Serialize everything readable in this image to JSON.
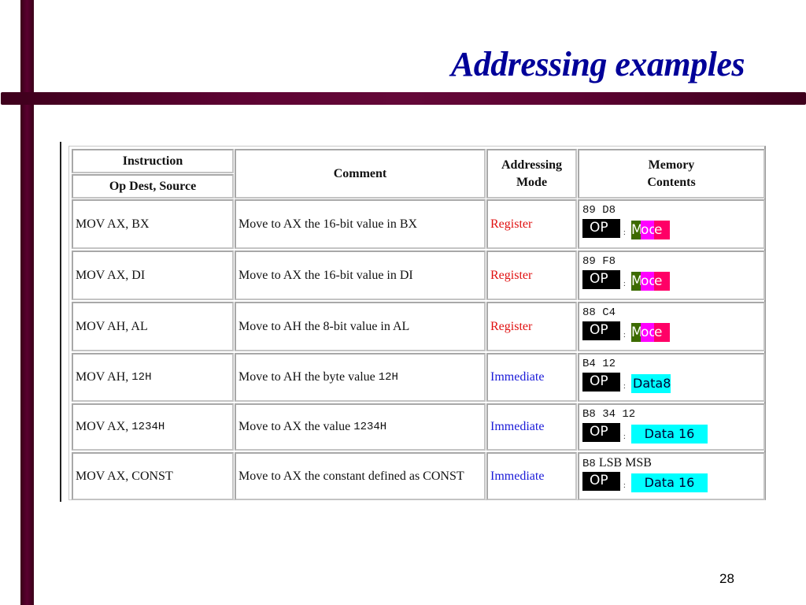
{
  "slide": {
    "title": "Addressing examples",
    "page_number": "28",
    "colors": {
      "title": "#000099",
      "bars": "#5a0030",
      "register": "#e01010",
      "immediate": "#1a1ad8",
      "op_box": "#000000",
      "mode_box_segments": [
        "#3d6a00",
        "#ff00ff",
        "#ff0066"
      ],
      "data_box": "#00ffff"
    }
  },
  "table": {
    "headers": {
      "instruction": "Instruction",
      "op_dest_source": "Op Dest, Source",
      "comment": "Comment",
      "addressing_mode_line1": "Addressing",
      "addressing_mode_line2": "Mode",
      "memory_contents_line1": "Memory",
      "memory_contents_line2": "Contents"
    },
    "rows": [
      {
        "instr_text": "MOV AX, BX",
        "instr_mono": "",
        "comment_text": "Move to AX the 16-bit value in BX",
        "comment_mono": "",
        "mode": "Register",
        "mode_type": "register",
        "bytes": "89 D8",
        "bytes_suffix": "",
        "op_label": "OP",
        "field_label_parts": [
          "M",
          "od",
          "e"
        ],
        "field_type": "mode"
      },
      {
        "instr_text": "MOV AX, DI",
        "instr_mono": "",
        "comment_text": "Move to AX the 16-bit value in DI",
        "comment_mono": "",
        "mode": "Register",
        "mode_type": "register",
        "bytes": "89 F8",
        "bytes_suffix": "",
        "op_label": "OP",
        "field_label_parts": [
          "M",
          "od",
          "e"
        ],
        "field_type": "mode"
      },
      {
        "instr_text": "MOV AH, AL",
        "instr_mono": "",
        "comment_text": "Move to AH the 8-bit value in AL",
        "comment_mono": "",
        "mode": "Register",
        "mode_type": "register",
        "bytes": "88 C4",
        "bytes_suffix": "",
        "op_label": "OP",
        "field_label_parts": [
          "M",
          "od",
          "e"
        ],
        "field_type": "mode"
      },
      {
        "instr_text": "MOV AH, ",
        "instr_mono": "12H",
        "comment_text": "Move to AH the byte value ",
        "comment_mono": "12H",
        "mode": "Immediate",
        "mode_type": "immediate",
        "bytes": "B4 12",
        "bytes_suffix": "",
        "op_label": "OP",
        "field_label": "Data8",
        "field_type": "data8"
      },
      {
        "instr_text": "MOV AX, ",
        "instr_mono": "1234H",
        "comment_text": "Move to AX the value ",
        "comment_mono": "1234H",
        "mode": "Immediate",
        "mode_type": "immediate",
        "bytes": "B8 34 12",
        "bytes_suffix": "",
        "op_label": "OP",
        "field_label": "Data 16",
        "field_type": "data16"
      },
      {
        "instr_text": "MOV AX, CONST",
        "instr_mono": "",
        "comment_text": "Move to AX the constant defined as CONST",
        "comment_mono": "",
        "mode": "Immediate",
        "mode_type": "immediate",
        "bytes": "B8",
        "bytes_suffix": " LSB MSB",
        "op_label": "OP",
        "field_label": "Data 16",
        "field_type": "data16"
      }
    ]
  }
}
